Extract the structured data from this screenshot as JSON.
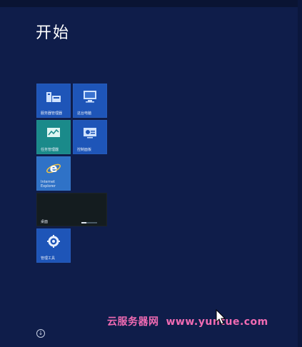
{
  "start": {
    "title": "开始"
  },
  "tiles": [
    {
      "id": "server-manager",
      "label": "服务器管理器",
      "icon": "server-manager-icon"
    },
    {
      "id": "this-pc",
      "label": "这台电脑",
      "icon": "computer-icon"
    },
    {
      "id": "task-manager",
      "label": "任务管理器",
      "icon": "task-manager-icon"
    },
    {
      "id": "control-panel",
      "label": "控制面板",
      "icon": "control-panel-icon"
    },
    {
      "id": "ie",
      "label_line1": "Internet",
      "label_line2": "Explorer",
      "icon": "internet-explorer-icon"
    },
    {
      "id": "desktop",
      "label": "桌面",
      "icon": "desktop-preview",
      "progress": 0.3
    },
    {
      "id": "admin-tools",
      "label": "管理工具",
      "icon": "admin-tools-icon"
    }
  ],
  "watermark": {
    "cn": "云服务器网",
    "site": "www.yuntue.com",
    "color": "#f16bb3"
  },
  "colors": {
    "background": "#0f1d4a",
    "tile_blue": "#1e55b8",
    "tile_teal": "#1a8a8a"
  }
}
